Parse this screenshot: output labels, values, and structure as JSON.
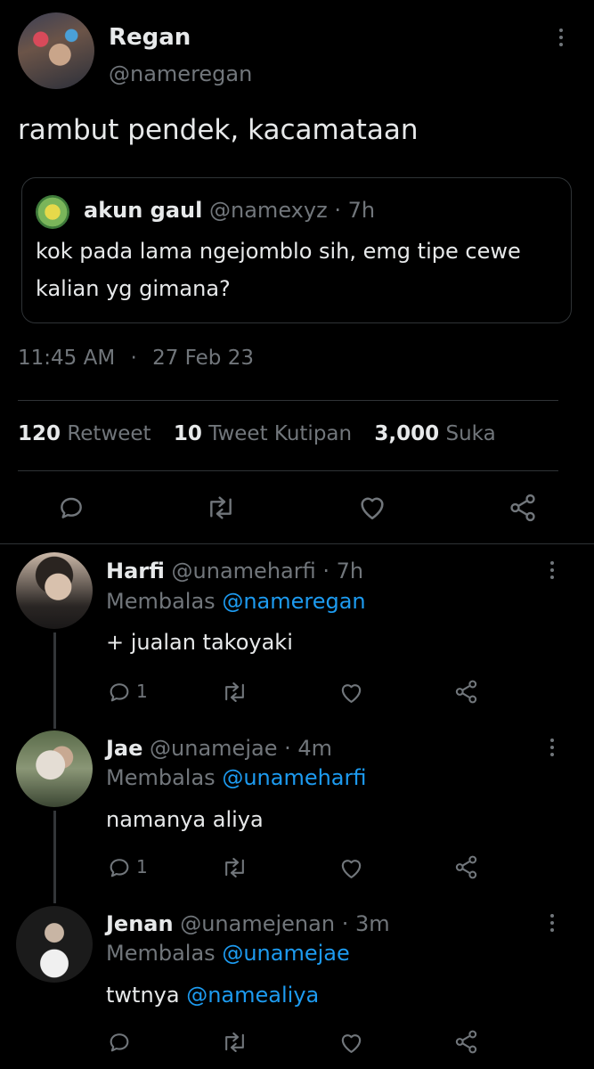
{
  "main_tweet": {
    "author_name": "Regan",
    "author_handle": "@nameregan",
    "text": "rambut pendek, kacamataan",
    "time": "11:45 AM",
    "separator": "·",
    "date": "27 Feb 23"
  },
  "quoted_tweet": {
    "author_name": "akun gaul",
    "author_handle": "@namexyz",
    "age": "· 7h",
    "text_line1": "kok pada lama ngejomblo sih, emg tipe cewe",
    "text_line2": "kalian yg gimana?"
  },
  "stats": {
    "retweets_count": "120",
    "retweets_label": "Retweet",
    "quotes_count": "10",
    "quotes_label": "Tweet Kutipan",
    "likes_count": "3,000",
    "likes_label": "Suka"
  },
  "replies": [
    {
      "author_name": "Harfi",
      "author_handle": "@unameharfi",
      "age": "· 7h",
      "replying_prefix": "Membalas",
      "replying_to": "@nameregan",
      "text": "+ jualan takoyaki",
      "reply_count": "1"
    },
    {
      "author_name": "Jae",
      "author_handle": "@unamejae",
      "age": "· 4m",
      "replying_prefix": "Membalas",
      "replying_to": "@unameharfi",
      "text": "namanya aliya",
      "reply_count": "1"
    },
    {
      "author_name": "Jenan",
      "author_handle": "@unamejenan",
      "age": "· 3m",
      "replying_prefix": "Membalas",
      "replying_to": "@unamejae",
      "text_prefix": "twtnya",
      "text_mention": "@namealiya",
      "reply_count": ""
    }
  ],
  "icons": {
    "reply": "reply-icon",
    "retweet": "retweet-icon",
    "like": "heart-icon",
    "share": "share-icon",
    "more": "more-vertical-icon"
  },
  "colors": {
    "background": "#000000",
    "text": "#e7e9ea",
    "secondary": "#71767b",
    "accent": "#1d9bf0",
    "border": "#2f3336"
  }
}
